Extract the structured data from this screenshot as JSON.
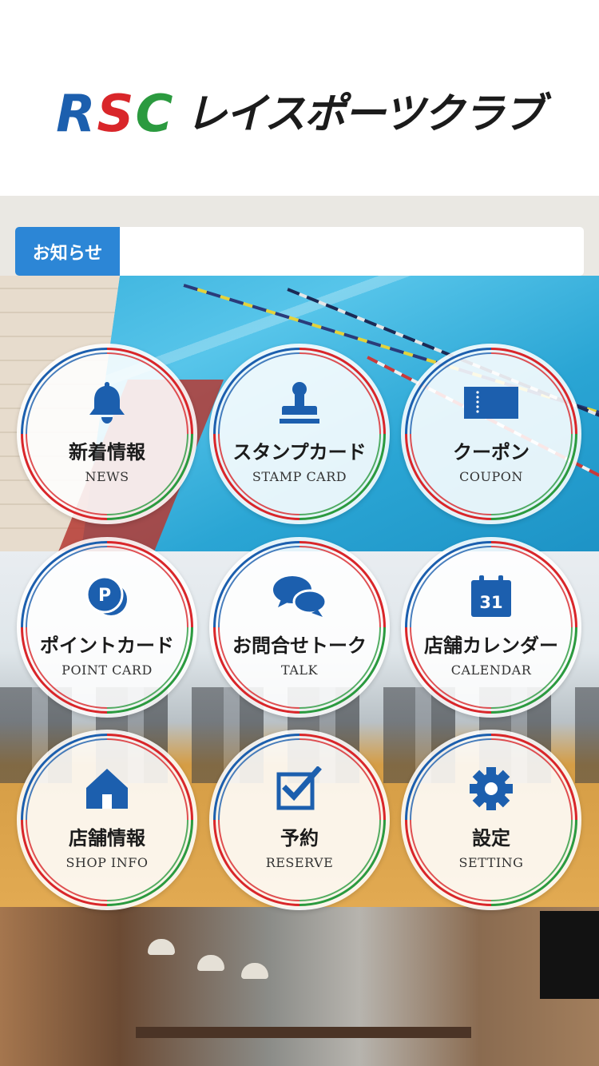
{
  "header": {
    "logo_rsc": [
      "R",
      "S",
      "C"
    ],
    "logo_name": "レイスポーツクラブ"
  },
  "notice": {
    "label": "お知らせ",
    "text": ""
  },
  "menu": [
    {
      "id": "news",
      "label_jp": "新着情報",
      "label_en": "NEWS",
      "icon": "bell-icon"
    },
    {
      "id": "stamp-card",
      "label_jp": "スタンプカード",
      "label_en": "STAMP CARD",
      "icon": "stamp-icon"
    },
    {
      "id": "coupon",
      "label_jp": "クーポン",
      "label_en": "COUPON",
      "icon": "ticket-icon"
    },
    {
      "id": "point-card",
      "label_jp": "ポイントカード",
      "label_en": "POINT CARD",
      "icon": "coins-icon"
    },
    {
      "id": "talk",
      "label_jp": "お問合せトーク",
      "label_en": "TALK",
      "icon": "chat-bubbles-icon"
    },
    {
      "id": "calendar",
      "label_jp": "店舗カレンダー",
      "label_en": "CALENDAR",
      "icon": "calendar-icon",
      "icon_text": "31"
    },
    {
      "id": "shop-info",
      "label_jp": "店舗情報",
      "label_en": "SHOP INFO",
      "icon": "house-icon"
    },
    {
      "id": "reserve",
      "label_jp": "予約",
      "label_en": "RESERVE",
      "icon": "checkbox-icon"
    },
    {
      "id": "setting",
      "label_jp": "設定",
      "label_en": "SETTING",
      "icon": "gear-icon"
    }
  ],
  "colors": {
    "brand_blue": "#1c5fae",
    "brand_red": "#d9262a",
    "brand_green": "#2b9a3f",
    "notice_label_bg": "#2c86d6"
  }
}
